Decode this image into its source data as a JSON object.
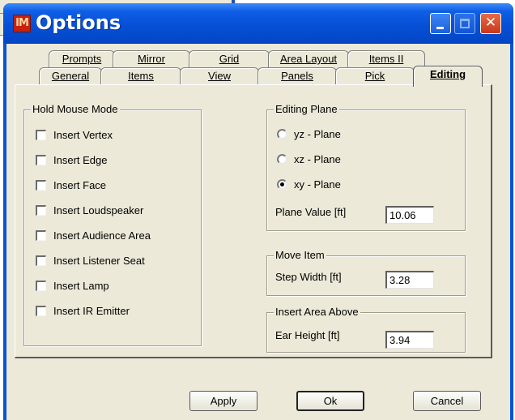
{
  "window": {
    "title": "Options",
    "icon_text": "IM"
  },
  "tabs_row1": [
    "Prompts",
    "Mirror",
    "Grid",
    "Area Layout",
    "Items II"
  ],
  "tabs_row2": [
    "General",
    "Items",
    "View",
    "Panels",
    "Pick",
    "Editing"
  ],
  "selected_tab": "Editing",
  "hold_mouse_mode": {
    "title": "Hold Mouse Mode",
    "items": [
      {
        "label": "Insert Vertex",
        "checked": false
      },
      {
        "label": "Insert Edge",
        "checked": false
      },
      {
        "label": "Insert Face",
        "checked": false
      },
      {
        "label": "Insert Loudspeaker",
        "checked": false
      },
      {
        "label": "Insert Audience Area",
        "checked": false
      },
      {
        "label": "Insert Listener Seat",
        "checked": false
      },
      {
        "label": "Insert Lamp",
        "checked": false
      },
      {
        "label": "Insert IR Emitter",
        "checked": false
      }
    ]
  },
  "editing_plane": {
    "title": "Editing Plane",
    "options": [
      {
        "label": "yz - Plane",
        "selected": false
      },
      {
        "label": "xz - Plane",
        "selected": false
      },
      {
        "label": "xy - Plane",
        "selected": true
      }
    ],
    "plane_value_label": "Plane Value [ft]",
    "plane_value": "10.06"
  },
  "move_item": {
    "title": "Move Item",
    "step_width_label": "Step Width [ft]",
    "step_width": "3.28"
  },
  "insert_area_above": {
    "title": "Insert Area Above",
    "ear_height_label": "Ear Height [ft]",
    "ear_height": "3.94"
  },
  "buttons": {
    "apply": "Apply",
    "ok": "Ok",
    "cancel": "Cancel"
  }
}
